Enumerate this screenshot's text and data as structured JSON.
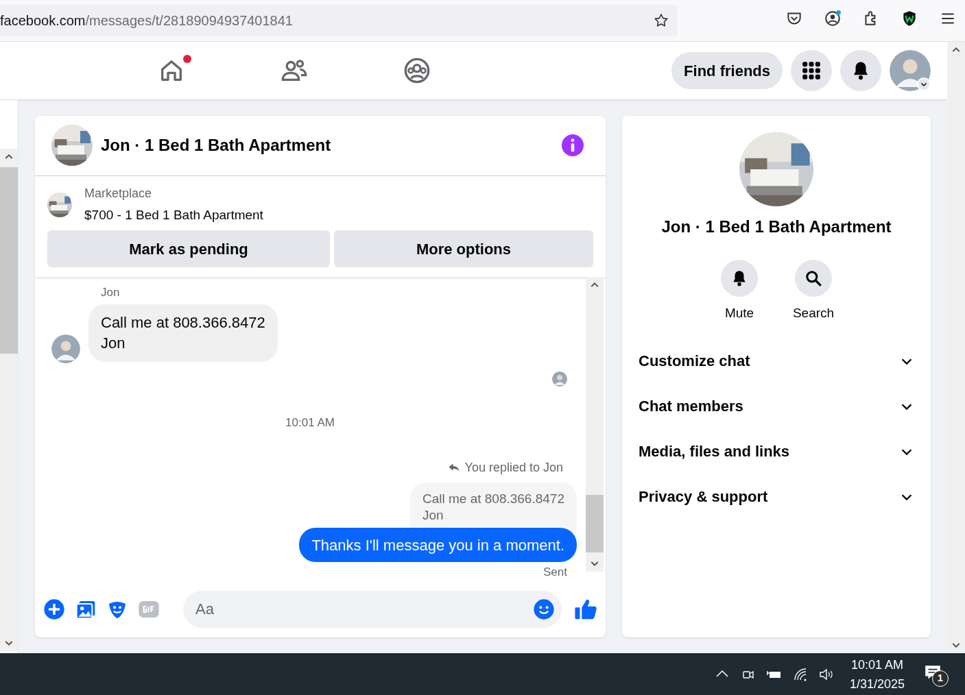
{
  "browser": {
    "url_domain": "facebook.com",
    "url_path": "/messages/t/28189094937401841"
  },
  "nav": {
    "tabs": [
      {
        "kind": "home",
        "dot": true
      },
      {
        "kind": "friends",
        "dot": false
      },
      {
        "kind": "groups",
        "dot": false
      }
    ],
    "find_friends": "Find friends"
  },
  "chat": {
    "title": "Jon · 1 Bed 1 Bath Apartment",
    "listing": {
      "label": "Marketplace",
      "title": "$700 - 1 Bed 1 Bath Apartment",
      "buttons": [
        "Mark as pending",
        "More options"
      ]
    },
    "messages": [
      {
        "kind": "incoming",
        "sender": "Jon",
        "text": "Call me at 808.366.8472\nJon"
      },
      {
        "kind": "seen"
      },
      {
        "kind": "timestamp",
        "text": "10:01 AM"
      },
      {
        "kind": "reply_note",
        "text": "You replied to Jon"
      },
      {
        "kind": "quoted",
        "text": "Call me at 808.366.8472\nJon"
      },
      {
        "kind": "outgoing",
        "text": "Thanks I'll message you in a moment."
      },
      {
        "kind": "status",
        "text": "Sent"
      }
    ],
    "composer": {
      "placeholder": "Aa"
    }
  },
  "details": {
    "title": "Jon · 1 Bed 1 Bath Apartment",
    "actions": [
      {
        "kind": "mute",
        "label": "Mute"
      },
      {
        "kind": "search",
        "label": "Search"
      }
    ],
    "sections": [
      "Customize chat",
      "Chat members",
      "Media, files and links",
      "Privacy & support"
    ]
  },
  "taskbar": {
    "time": "10:01 AM",
    "date": "1/31/2025",
    "notifications": "1"
  }
}
